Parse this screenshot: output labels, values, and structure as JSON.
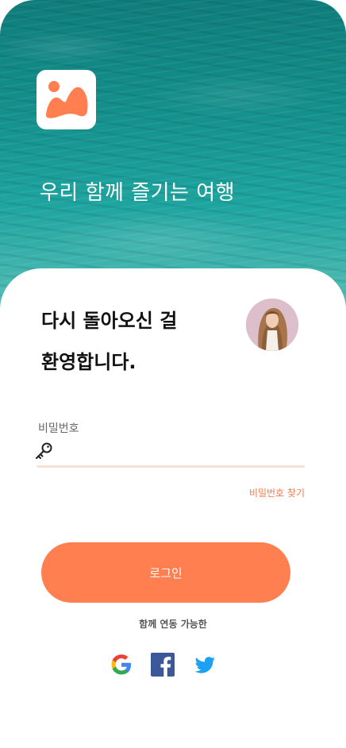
{
  "hero": {
    "tagline": "우리 함께 즐기는 여행",
    "logo_icon": "mountain-photo-icon",
    "accent_color": "#ff7f50"
  },
  "card": {
    "welcome_line1": "다시 돌아오신 걸",
    "welcome_line2": "환영합니다.",
    "avatar_icon": "user-avatar"
  },
  "form": {
    "password_label": "비밀번호",
    "password_value": "",
    "password_placeholder": "",
    "forgot_password": "비밀번호 찾기",
    "login_button": "로그인"
  },
  "social": {
    "caption": "함께 연동 가능한",
    "providers": [
      "google-icon",
      "facebook-icon",
      "twitter-icon"
    ]
  }
}
